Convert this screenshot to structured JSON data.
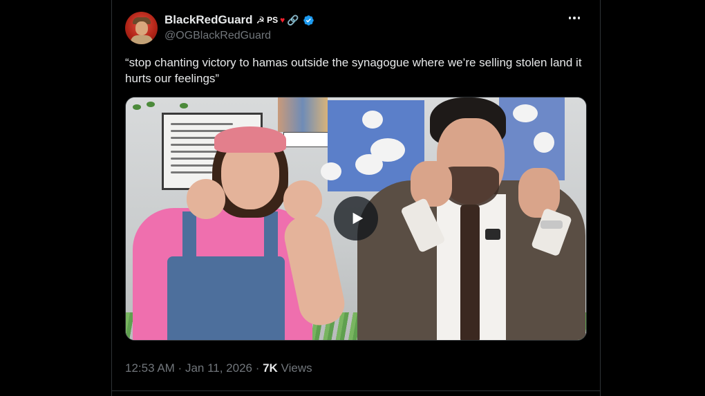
{
  "author": {
    "display_name": "BlackRedGuard",
    "flair": {
      "sickle": "☭",
      "ps": "PS",
      "heart": "♥",
      "links": "🔗"
    },
    "handle": "@OGBlackRedGuard",
    "verified": true
  },
  "tweet": {
    "text": "“stop chanting victory to hamas outside the synagogue where we’re selling stolen land it hurts our feelings”",
    "media_type": "video"
  },
  "meta": {
    "time": "12:53 AM",
    "separator1": " · ",
    "date": "Jan 11, 2026",
    "separator2": " · ",
    "views_count": "7K",
    "views_label": " Views"
  },
  "colors": {
    "background": "#000000",
    "text": "#e7e9ea",
    "muted": "#71767b",
    "verified_blue": "#1d9bf0",
    "divider": "#2f3336"
  },
  "icons": {
    "more": "more-horizontal-icon",
    "verified": "verified-badge-icon",
    "play": "play-icon"
  }
}
